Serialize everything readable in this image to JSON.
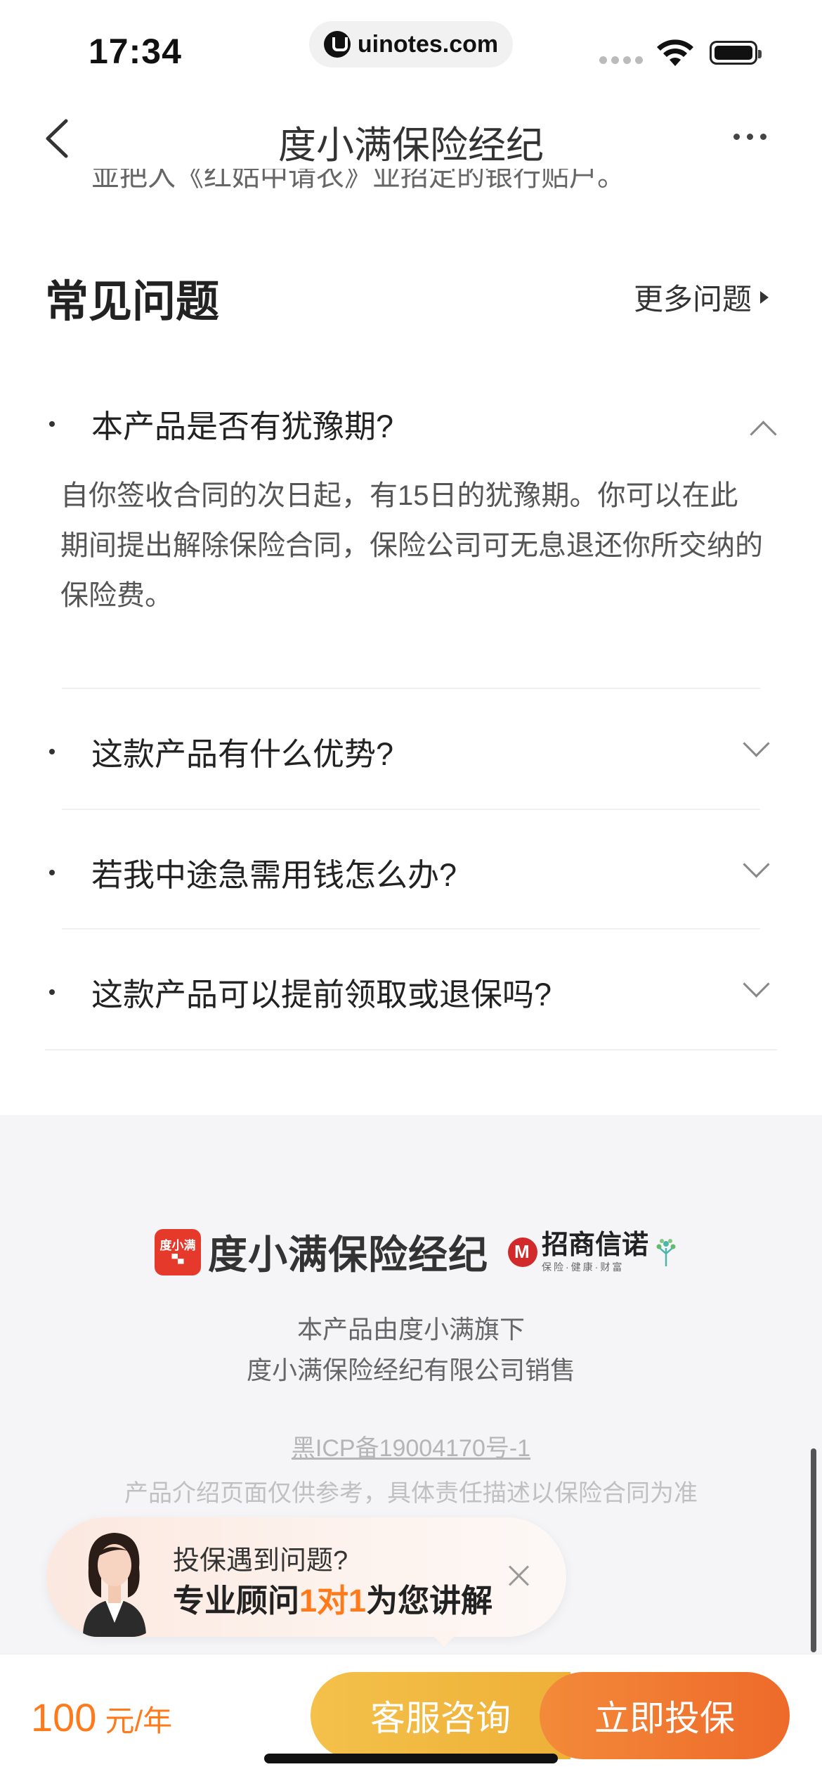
{
  "status_bar": {
    "time": "17:34",
    "url": "uinotes.com"
  },
  "nav": {
    "title": "度小满保险经纪",
    "clipped_text": "並把入《红姑中请衣》业招定的银行贴户。"
  },
  "faq": {
    "title": "常见问题",
    "more_label": "更多问题",
    "items": [
      {
        "question": "本产品是否有犹豫期?",
        "expanded": true,
        "answer": "自你签收合同的次日起，有15日的犹豫期。你可以在此期间提出解除保险合同，保险公司可无息退还你所交纳的保险费。"
      },
      {
        "question": "这款产品有什么优势?",
        "expanded": false
      },
      {
        "question": "若我中途急需用钱怎么办?",
        "expanded": false
      },
      {
        "question": "这款产品可以提前领取或退保吗?",
        "expanded": false
      }
    ]
  },
  "footer": {
    "brand_logo_text": "度小满",
    "brand_name": "度小满保险经纪",
    "partner_name": "招商信诺",
    "partner_tagline": "保险·健康·财富",
    "line1": "本产品由度小满旗下",
    "line2": "度小满保险经纪有限公司销售",
    "icp": "黑ICP备19004170号-1",
    "disclaimer": "产品介绍页面仅供参考，具体责任描述以保险合同为准"
  },
  "consult": {
    "question": "投保遇到问题?",
    "main_prefix": "专业顾问",
    "main_highlight": "1对1",
    "main_suffix": "为您讲解"
  },
  "bottom_bar": {
    "price": "100",
    "price_unit": "元/年",
    "service_button": "客服咨询",
    "buy_button": "立即投保"
  },
  "colors": {
    "accent_orange": "#ff7a1a",
    "service_yellow": "#f4c14a",
    "buy_orange": "#ee6a2a",
    "brand_red": "#e5392b"
  }
}
